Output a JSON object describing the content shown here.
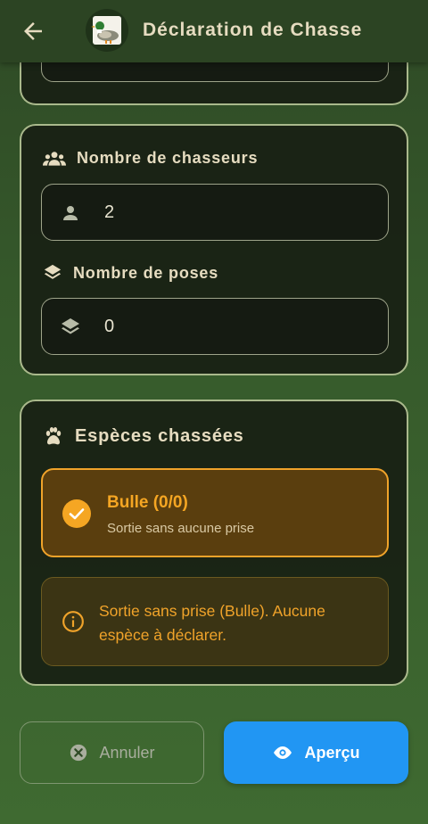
{
  "appbar": {
    "title": "Déclaration de Chasse",
    "back_icon": "arrow-left-icon",
    "logo_icon": "duck-logo"
  },
  "form": {
    "hunters": {
      "label": "Nombre de chasseurs",
      "icon": "group-icon",
      "value": "2",
      "field_icon": "person-icon"
    },
    "poses": {
      "label": "Nombre de poses",
      "icon": "layers-icon",
      "value": "0",
      "field_icon": "layers-icon"
    }
  },
  "species": {
    "title": "Espèces chassées",
    "icon": "paw-icon",
    "selected": {
      "title": "Bulle (0/0)",
      "subtitle": "Sortie sans aucune prise",
      "icon": "check-circle-icon"
    },
    "info": {
      "text": "Sortie sans prise (Bulle). Aucune espèce à déclarer.",
      "icon": "info-icon"
    }
  },
  "actions": {
    "cancel_label": "Annuler",
    "preview_label": "Aperçu"
  },
  "colors": {
    "accent_orange": "#f5a623",
    "primary_blue": "#2196f3",
    "card_border": "#aab98c"
  }
}
